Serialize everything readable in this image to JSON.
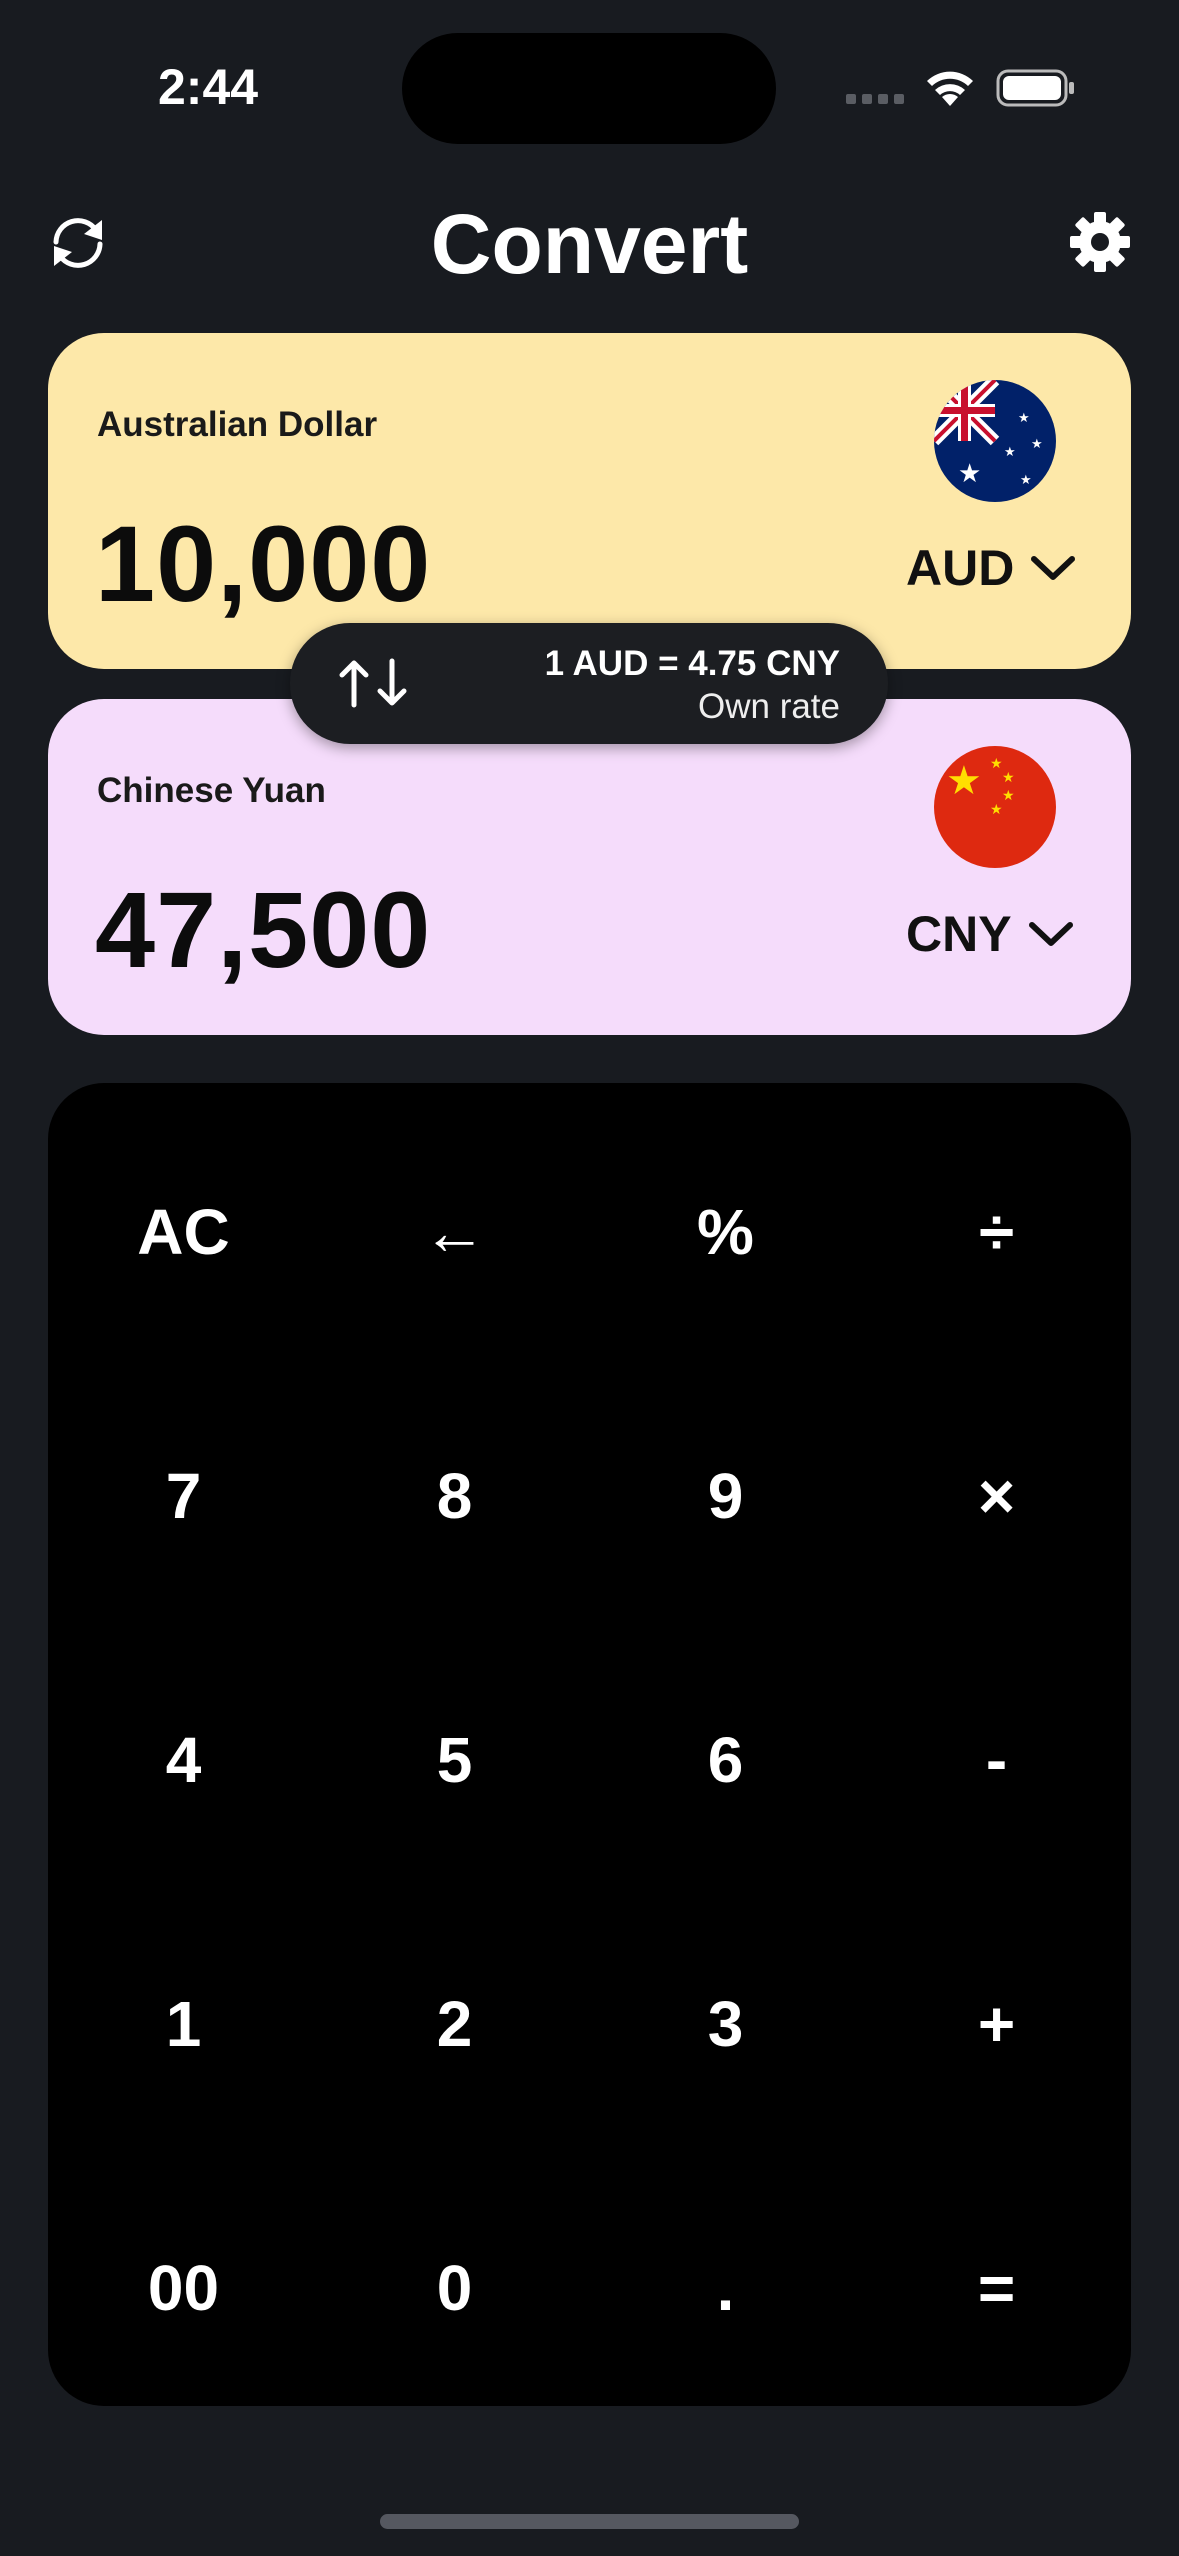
{
  "status_bar": {
    "time": "2:44"
  },
  "header": {
    "title": "Convert",
    "left_icon": "refresh-icon",
    "right_icon": "gear-icon"
  },
  "from_currency": {
    "name": "Australian Dollar",
    "amount": "10,000",
    "code": "AUD",
    "flag": "australia-flag",
    "background": "#fde8a9"
  },
  "to_currency": {
    "name": "Chinese Yuan",
    "amount": "47,500",
    "code": "CNY",
    "flag": "china-flag",
    "background": "#f5dcfb"
  },
  "rate": {
    "text": "1 AUD = 4.75 CNY",
    "source": "Own rate",
    "icon": "swap-arrows-icon"
  },
  "keypad": {
    "keys": [
      [
        "AC",
        "←",
        "%",
        "÷"
      ],
      [
        "7",
        "8",
        "9",
        "×"
      ],
      [
        "4",
        "5",
        "6",
        "-"
      ],
      [
        "1",
        "2",
        "3",
        "+"
      ],
      [
        "00",
        "0",
        ".",
        "="
      ]
    ]
  },
  "colors": {
    "background": "#181b20",
    "keypad": "#000000"
  }
}
